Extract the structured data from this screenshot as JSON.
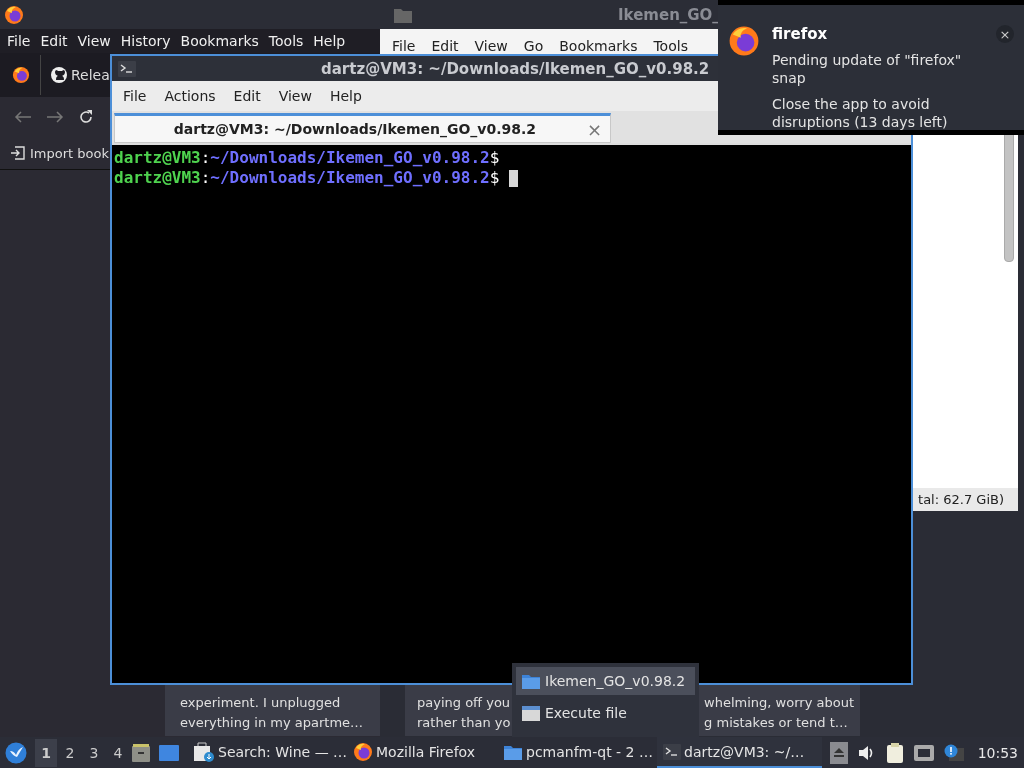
{
  "firefox_window": {
    "menu": [
      "File",
      "Edit",
      "View",
      "History",
      "Bookmarks",
      "Tools",
      "Help"
    ],
    "tab_label": "Relea",
    "bookmark": "Import book"
  },
  "file_manager_window": {
    "title": "Ikemen_GO_",
    "menu": [
      "File",
      "Edit",
      "View",
      "Go",
      "Bookmarks",
      "Tools"
    ],
    "status": "tal: 62.7 GiB)"
  },
  "terminal_window": {
    "title": "dartz@VM3: ~/Downloads/Ikemen_GO_v0.98.2",
    "menu": [
      "File",
      "Actions",
      "Edit",
      "View",
      "Help"
    ],
    "tabs": [
      {
        "label": "dartz@VM3: ~/Downloads/Ikemen_GO_v0.98.2",
        "close": "×",
        "selected": true
      }
    ],
    "lines": [
      {
        "user": "dartz@VM3",
        "sep": ":",
        "path": "~/Downloads/Ikemen_GO_v0.98.2",
        "prompt": "$",
        "cursor": false
      },
      {
        "user": "dartz@VM3",
        "sep": ":",
        "path": "~/Downloads/Ikemen_GO_v0.98.2",
        "prompt": "$",
        "cursor": true
      }
    ]
  },
  "notification": {
    "app": "firefox",
    "lines": [
      "Pending update of \"firefox\" snap",
      "Close the app to avoid disruptions (13 days left)"
    ],
    "close": "×"
  },
  "previews": [
    {
      "columns": [
        [
          "experiment. I unplugged",
          "everything in my apartme…"
        ]
      ]
    },
    {
      "columns": [
        [
          "paying off you",
          "rather than yo"
        ],
        [
          "whelming, worry about",
          "g mistakes or tend t…"
        ]
      ]
    }
  ],
  "context_menu": {
    "items": [
      {
        "label": "Ikemen_GO_v0.98.2",
        "kind": "folder",
        "selected": true
      },
      {
        "label": "Execute file",
        "kind": "window",
        "selected": false
      }
    ]
  },
  "taskbar": {
    "desktops": [
      {
        "label": "1",
        "selected": true
      },
      {
        "label": "2",
        "selected": false
      },
      {
        "label": "3",
        "selected": false
      },
      {
        "label": "4",
        "selected": false
      }
    ],
    "tasks": [
      {
        "label": "Search: Wine — …",
        "kind": "store",
        "selected": false
      },
      {
        "label": "Mozilla Firefox",
        "kind": "firefox",
        "selected": false
      },
      {
        "label": "pcmanfm-qt - 2 …",
        "kind": "folder",
        "selected": false
      },
      {
        "label": "dartz@VM3: ~/…",
        "kind": "terminal",
        "selected": true
      }
    ],
    "clock": "10:53"
  }
}
